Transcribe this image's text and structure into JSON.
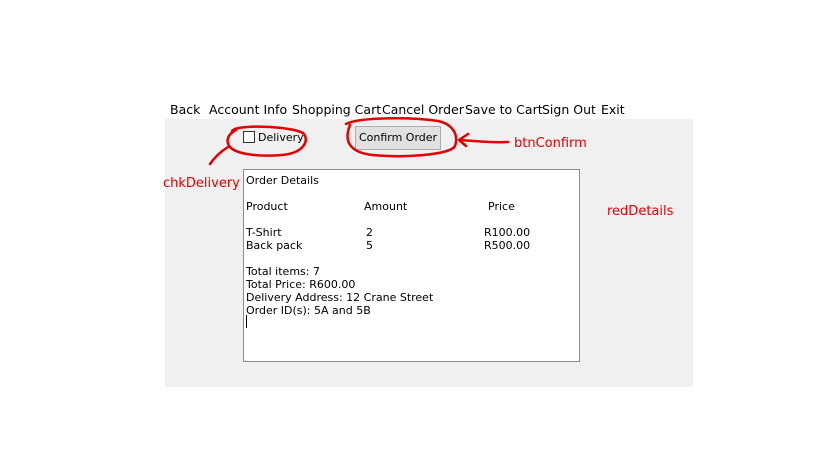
{
  "menu": {
    "items": [
      "Back",
      "Account Info",
      "Shopping Cart",
      "Cancel Order",
      "Save to Cart",
      "Sign Out",
      "Exit"
    ]
  },
  "form": {
    "delivery_checkbox": {
      "label": "Delivery",
      "checked": false
    },
    "confirm_button": {
      "label": "Confirm Order"
    },
    "details": {
      "heading": "Order Details",
      "columns": [
        "Product",
        "Amount",
        "Price"
      ],
      "rows": [
        [
          "T-Shirt",
          "2",
          "R100.00"
        ],
        [
          "Back pack",
          "5",
          "R500.00"
        ]
      ],
      "total_items": "Total items: 7",
      "total_price": "Total Price: R600.00",
      "delivery_address": "Delivery Address: 12 Crane Street",
      "order_ids": "Order ID(s): 5A and 5B"
    }
  },
  "annotations": {
    "chk_delivery": "chkDelivery",
    "btn_confirm": "btnConfirm",
    "red_details": "redDetails",
    "color": "#e30000"
  }
}
